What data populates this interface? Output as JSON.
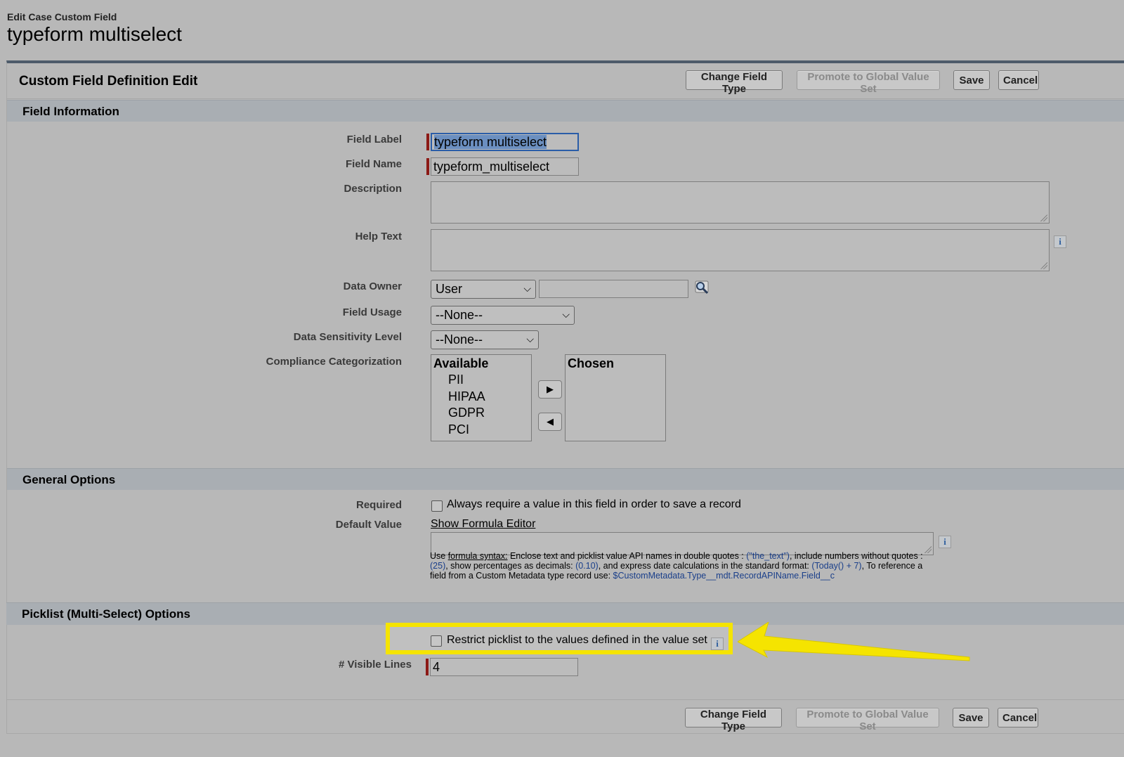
{
  "header": {
    "subtitle": "Edit Case Custom Field",
    "title": "typeform multiselect"
  },
  "panel": {
    "title": "Custom Field Definition Edit",
    "buttons": {
      "change_field_type": "Change Field Type",
      "promote": "Promote to Global Value Set",
      "save": "Save",
      "cancel": "Cancel"
    }
  },
  "field_information": {
    "heading": "Field Information",
    "field_label": {
      "label": "Field Label",
      "value": "typeform multiselect"
    },
    "field_name": {
      "label": "Field Name",
      "value": "typeform_multiselect"
    },
    "description": {
      "label": "Description",
      "value": ""
    },
    "help_text": {
      "label": "Help Text",
      "value": ""
    },
    "data_owner": {
      "label": "Data Owner",
      "type_value": "User",
      "lookup_value": ""
    },
    "field_usage": {
      "label": "Field Usage",
      "value": "--None--"
    },
    "data_sensitivity": {
      "label": "Data Sensitivity Level",
      "value": "--None--"
    },
    "compliance": {
      "label": "Compliance Categorization",
      "available_header": "Available",
      "available": [
        "PII",
        "HIPAA",
        "GDPR",
        "PCI"
      ],
      "chosen_header": "Chosen",
      "chosen": []
    }
  },
  "general_options": {
    "heading": "General Options",
    "required": {
      "label": "Required",
      "text": "Always require a value in this field in order to save a record",
      "checked": false
    },
    "default_value": {
      "label": "Default Value",
      "link": "Show Formula Editor",
      "value": "",
      "help": {
        "p1": "Use ",
        "formula_syntax": "formula syntax:",
        "p2": " Enclose text and picklist value API names in double quotes : ",
        "ex1": "(\"the_text\")",
        "p3": ", include numbers without quotes : ",
        "ex2": "(25)",
        "p4": ", show percentages as decimals: ",
        "ex3": "(0.10)",
        "p5": ", and express date calculations in the standard format: ",
        "ex4": "(Today() + 7)",
        "p6": ", To reference a field from a Custom Metadata type record use: ",
        "ex5": "$CustomMetadata.Type__mdt.RecordAPIName.Field__c"
      }
    }
  },
  "picklist_options": {
    "heading": "Picklist (Multi-Select) Options",
    "restrict": {
      "text": "Restrict picklist to the values defined in the value set",
      "checked": false
    },
    "visible_lines": {
      "label": "# Visible Lines",
      "value": "4"
    }
  },
  "colors": {
    "highlight": "#f5e400",
    "required_bar": "#8c1a16",
    "panel_top_border": "#4d5b6a"
  },
  "icons": {
    "info": "info-icon",
    "lookup": "magnifier-lookup-icon",
    "move_right": "triangle-right-icon",
    "move_left": "triangle-left-icon",
    "dropdown": "chevron-down-icon",
    "annotation": "yellow-arrow-annotation"
  }
}
